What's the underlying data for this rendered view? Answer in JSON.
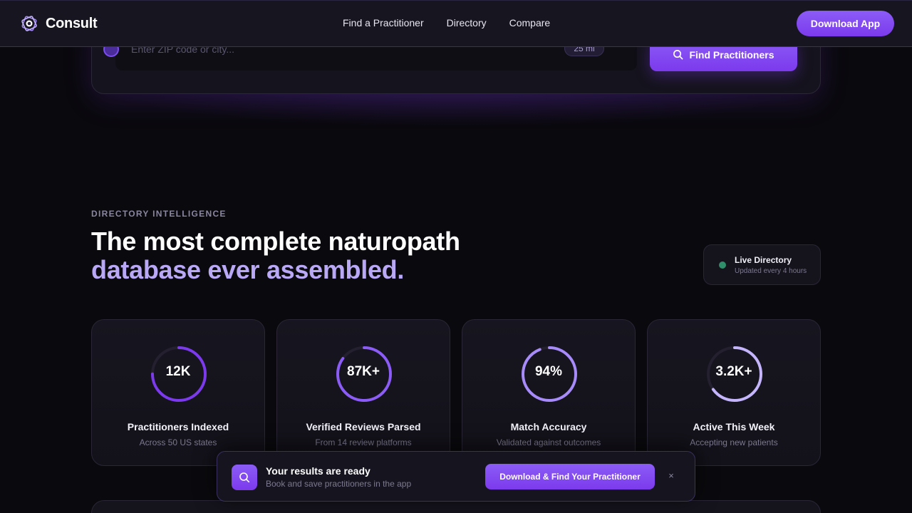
{
  "nav": {
    "brand": "Consult",
    "links": [
      "Find a Practitioner",
      "Directory",
      "Compare"
    ],
    "download_label": "Download App"
  },
  "search": {
    "placeholder": "Enter ZIP code or city...",
    "radius": "25 mi",
    "button_label": "Find Practitioners"
  },
  "section": {
    "eyebrow": "DIRECTORY INTELLIGENCE",
    "headline_line1": "The most complete naturopath",
    "headline_line2": "database ever assembled.",
    "live": {
      "title": "Live Directory",
      "subtitle": "Updated every 4 hours",
      "status_color": "#2f8f6a"
    }
  },
  "stats": [
    {
      "value": "12K",
      "label": "Practitioners Indexed",
      "sub": "Across 50 US states",
      "fill": 0.75,
      "color": "#7c3aed"
    },
    {
      "value": "87K+",
      "label": "Verified Reviews Parsed",
      "sub": "From 14 review platforms",
      "fill": 0.85,
      "color": "#8b5cf6"
    },
    {
      "value": "94%",
      "label": "Match Accuracy",
      "sub": "Validated against outcomes",
      "fill": 0.94,
      "color": "#a78bfa"
    },
    {
      "value": "3.2K+",
      "label": "Active This Week",
      "sub": "Accepting new patients",
      "fill": 0.65,
      "color": "#c4b5fd"
    }
  ],
  "toast": {
    "title": "Your results are ready",
    "subtitle": "Book and save practitioners in the app",
    "cta": "Download & Find Your Practitioner",
    "close": "×"
  },
  "colors": {
    "accent": "#7c3aed",
    "accent_light": "#b9a8f5",
    "background": "#0a090d"
  }
}
